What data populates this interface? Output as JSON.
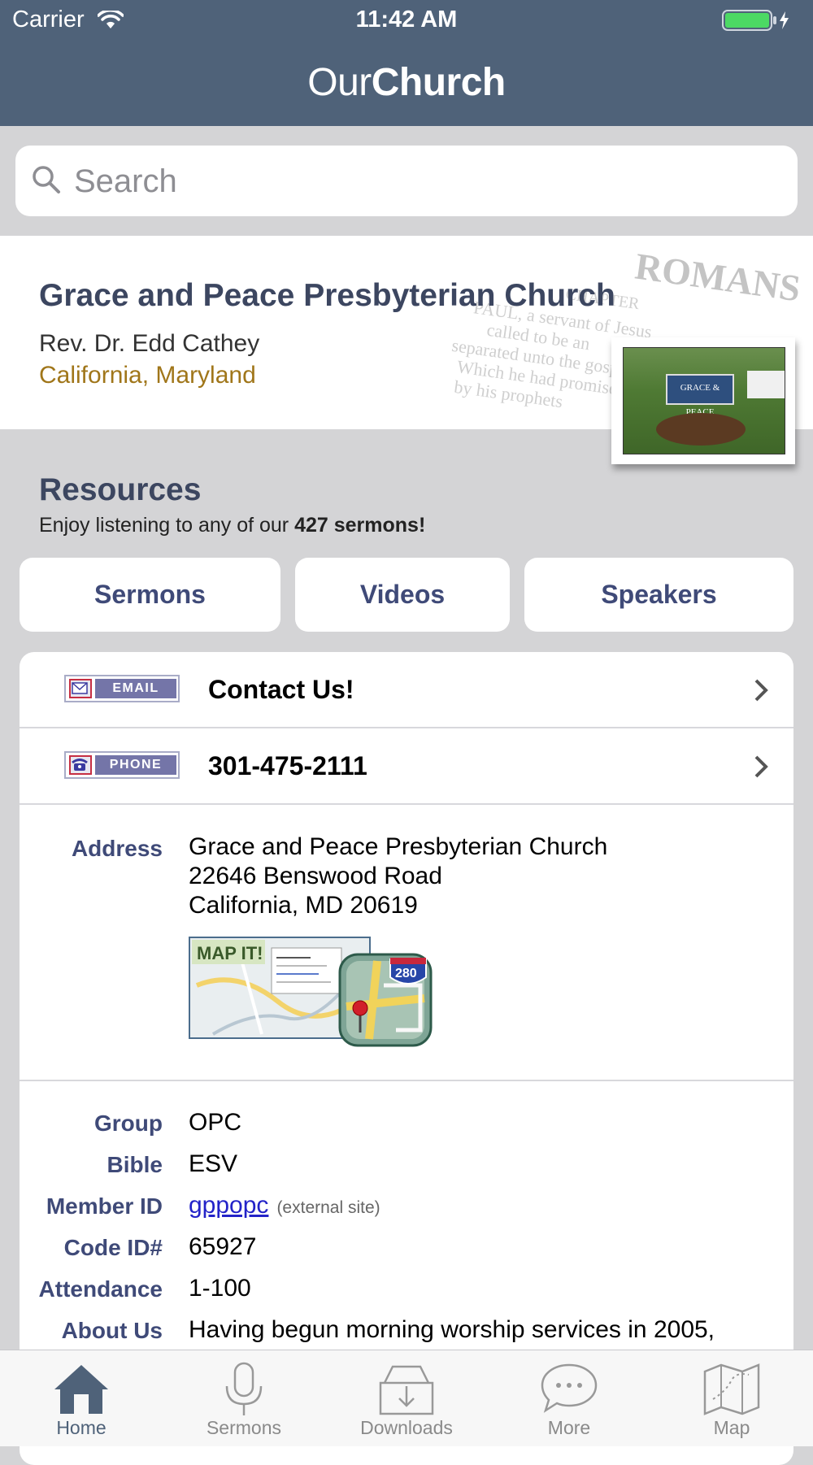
{
  "status_bar": {
    "carrier": "Carrier",
    "time": "11:42 AM"
  },
  "app": {
    "logo_part1": "Our",
    "logo_part2": "Church"
  },
  "search": {
    "placeholder": "Search"
  },
  "church": {
    "name": "Grace and Peace Presbyterian Church",
    "pastor": "Rev. Dr. Edd Cathey",
    "location": "California, Maryland",
    "background_words": [
      "ROMANS",
      "CHAPTER",
      "PAUL, a servant of Jesus",
      "called to be an",
      "separated unto the gospel",
      "Which he had promised",
      "by his prophets"
    ],
    "sign_text": "GRACE & PEACE"
  },
  "resources": {
    "title": "Resources",
    "subtitle_prefix": "Enjoy listening to any of our ",
    "subtitle_bold": "427 sermons!",
    "buttons": [
      "Sermons",
      "Videos",
      "Speakers"
    ]
  },
  "contact": {
    "email_badge": "EMAIL",
    "email_label": "Contact Us!",
    "phone_badge": "PHONE",
    "phone_label": "301-475-2111"
  },
  "address": {
    "label": "Address",
    "lines": [
      "Grace and Peace Presbyterian Church",
      "22646 Benswood Road",
      "California, MD 20619"
    ],
    "map_label": "MAP IT!",
    "map_shield": "280"
  },
  "details": {
    "group_label": "Group",
    "group_value": "OPC",
    "bible_label": "Bible",
    "bible_value": "ESV",
    "member_label": "Member ID",
    "member_value": "gppopc",
    "member_note": "(external site)",
    "code_label": "Code ID#",
    "code_value": "65927",
    "attendance_label": "Attendance",
    "attendance_value": "1-100",
    "about_label": "About Us",
    "about_value": "Having begun morning worship services in 2005,"
  },
  "tabs": [
    {
      "label": "Home",
      "icon": "home-icon",
      "active": true
    },
    {
      "label": "Sermons",
      "icon": "microphone-icon",
      "active": false
    },
    {
      "label": "Downloads",
      "icon": "download-icon",
      "active": false
    },
    {
      "label": "More",
      "icon": "chat-bubble-icon",
      "active": false
    },
    {
      "label": "Map",
      "icon": "map-icon",
      "active": false
    }
  ],
  "colors": {
    "header": "#4f6279",
    "accent_text": "#3f4a78",
    "location": "#a0761a",
    "battery": "#4cd964"
  }
}
